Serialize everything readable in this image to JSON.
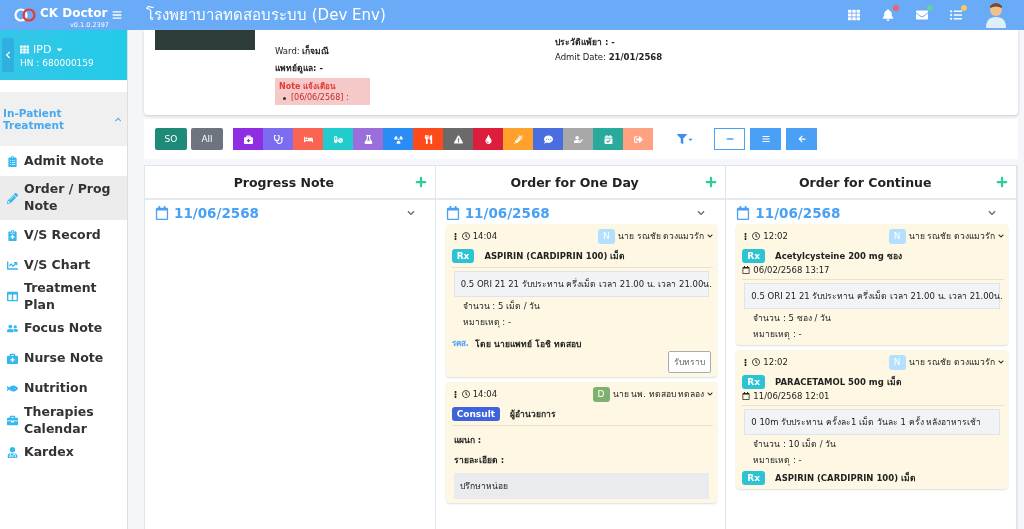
{
  "header": {
    "brand": "CK Doctor",
    "version": "v0.1.0.2397",
    "title": "โรงพยาบาลทดสอบระบบ (Dev Env)",
    "notifications": [
      {
        "color": "#f06070"
      },
      {
        "color": "#5fd3a0"
      },
      {
        "color": "#f5c860"
      }
    ]
  },
  "sidebar": {
    "module": "IPD",
    "hn": "HN : 680000159",
    "section": {
      "label": "In-Patient Treatment",
      "expanded": true
    },
    "items": [
      {
        "label": "Admit Note",
        "selected": false
      },
      {
        "label": "Order / Prog Note",
        "selected": true
      },
      {
        "label": "V/S Record",
        "selected": false
      },
      {
        "label": "V/S Chart",
        "selected": false
      },
      {
        "label": "Treatment Plan",
        "selected": false
      },
      {
        "label": "Focus Note",
        "selected": false
      },
      {
        "label": "Nurse Note",
        "selected": false
      },
      {
        "label": "Nutrition",
        "selected": false
      },
      {
        "label": "Therapies Calendar",
        "selected": false
      },
      {
        "label": "Kardex",
        "selected": false
      }
    ]
  },
  "patient": {
    "ward_label": "Ward:",
    "ward": "เก็จมณี",
    "doctor_label": "แพทย์ดูแล:",
    "doctor": "-",
    "note_title": "Note แจ้งเตือน",
    "notes": [
      "[06/06/2568] :"
    ],
    "allergy_label": "ประวัติแพ้ยา :",
    "allergy": "-",
    "admit_label": "Admit Date:",
    "admit": "21/01/2568"
  },
  "toolbar": {
    "filters": [
      {
        "label": "SO",
        "color": "#1e8a78"
      },
      {
        "label": "All",
        "color": "#6c757d"
      }
    ],
    "categories": [
      {
        "color": "#8e2de2"
      },
      {
        "color": "#7b6cf0"
      },
      {
        "color": "#fa6450"
      },
      {
        "color": "#22cccc"
      },
      {
        "color": "#9a6fdc"
      },
      {
        "color": "#2a8cf5"
      },
      {
        "color": "#fc4a1a"
      },
      {
        "color": "#6a6a6a"
      },
      {
        "color": "#dc1e3c"
      },
      {
        "color": "#ffa12a"
      },
      {
        "color": "#4a6ee0"
      },
      {
        "color": "#a8a8a8"
      },
      {
        "color": "#2aaa9a"
      },
      {
        "color": "#ffa080"
      }
    ],
    "views": [
      {
        "selected": true
      },
      {
        "selected": false
      },
      {
        "selected": false
      }
    ]
  },
  "columns": [
    {
      "title": "Progress Note",
      "date": "11/06/2568"
    },
    {
      "title": "Order for One Day",
      "date": "11/06/2568",
      "cards": [
        {
          "kind": "rx",
          "time": "14:04",
          "badge": {
            "label": "N",
            "color": "#b3e0ff"
          },
          "author": "นาย รณชัย ดวงแมวรัก",
          "orders": [
            {
              "tag": {
                "label": "Rx",
                "color": "#2cc4d4"
              },
              "title": "ASPIRIN (CARDIPRIN 100) เม็ด",
              "instruction": "0.5 ORI 21 21 รับประทาน ครึ่งเม็ด เวลา 21.00 น. เวลา 21.00น.",
              "qty": "จำนวน : 5 เม็ด / วัน",
              "remark": "หมายเหตุ : -"
            }
          ],
          "signer_role": "รคส.",
          "signer": "โดย นายแพทย์ โอชิ ทดสอบ",
          "ack": "รับทราบ"
        },
        {
          "kind": "consult",
          "time": "14:04",
          "badge": {
            "label": "D",
            "color": "#7fb070"
          },
          "author": "นาย นพ. ทดสอบ ทดลอง",
          "orders": [
            {
              "tag": {
                "label": "Consult",
                "color": "#3d63dd"
              },
              "title": "ผู้อำนวยการ"
            }
          ],
          "fields": [
            "แผนก :",
            "รายละเอียด :"
          ],
          "detail": "ปรึกษาหน่อย"
        }
      ]
    },
    {
      "title": "Order for Continue",
      "date": "11/06/2568",
      "cards": [
        {
          "kind": "rx",
          "time": "12:02",
          "badge": {
            "label": "N",
            "color": "#b3e0ff"
          },
          "author": "นาย รณชัย ดวงแมวรัก",
          "orders": [
            {
              "tag": {
                "label": "Rx",
                "color": "#2cc4d4"
              },
              "title": "Acetylcysteine 200 mg ซอง",
              "date": "06/02/2568 13:17",
              "instruction": "0.5 ORI 21 21 รับประทาน ครึ่งเม็ด เวลา 21.00 น. เวลา 21.00น.",
              "qty": "จำนวน : 5 ซอง / วัน",
              "remark": "หมายเหตุ : -"
            }
          ]
        },
        {
          "kind": "rx",
          "time": "12:02",
          "badge": {
            "label": "N",
            "color": "#b3e0ff"
          },
          "author": "นาย รณชัย ดวงแมวรัก",
          "orders": [
            {
              "tag": {
                "label": "Rx",
                "color": "#2cc4d4"
              },
              "title": "PARACETAMOL 500 mg เม็ด",
              "date": "11/06/2568 12:01",
              "instruction": "0 10m รับประทาน ครั้งละ1 เม็ด วันละ 1 ครั้ง หลังอาหารเช้า",
              "qty": "จำนวน : 10 เม็ด / วัน",
              "remark": "หมายเหตุ : -"
            },
            {
              "tag": {
                "label": "Rx",
                "color": "#2cc4d4"
              },
              "title": "ASPIRIN (CARDIPRIN 100) เม็ด"
            }
          ]
        }
      ]
    }
  ]
}
